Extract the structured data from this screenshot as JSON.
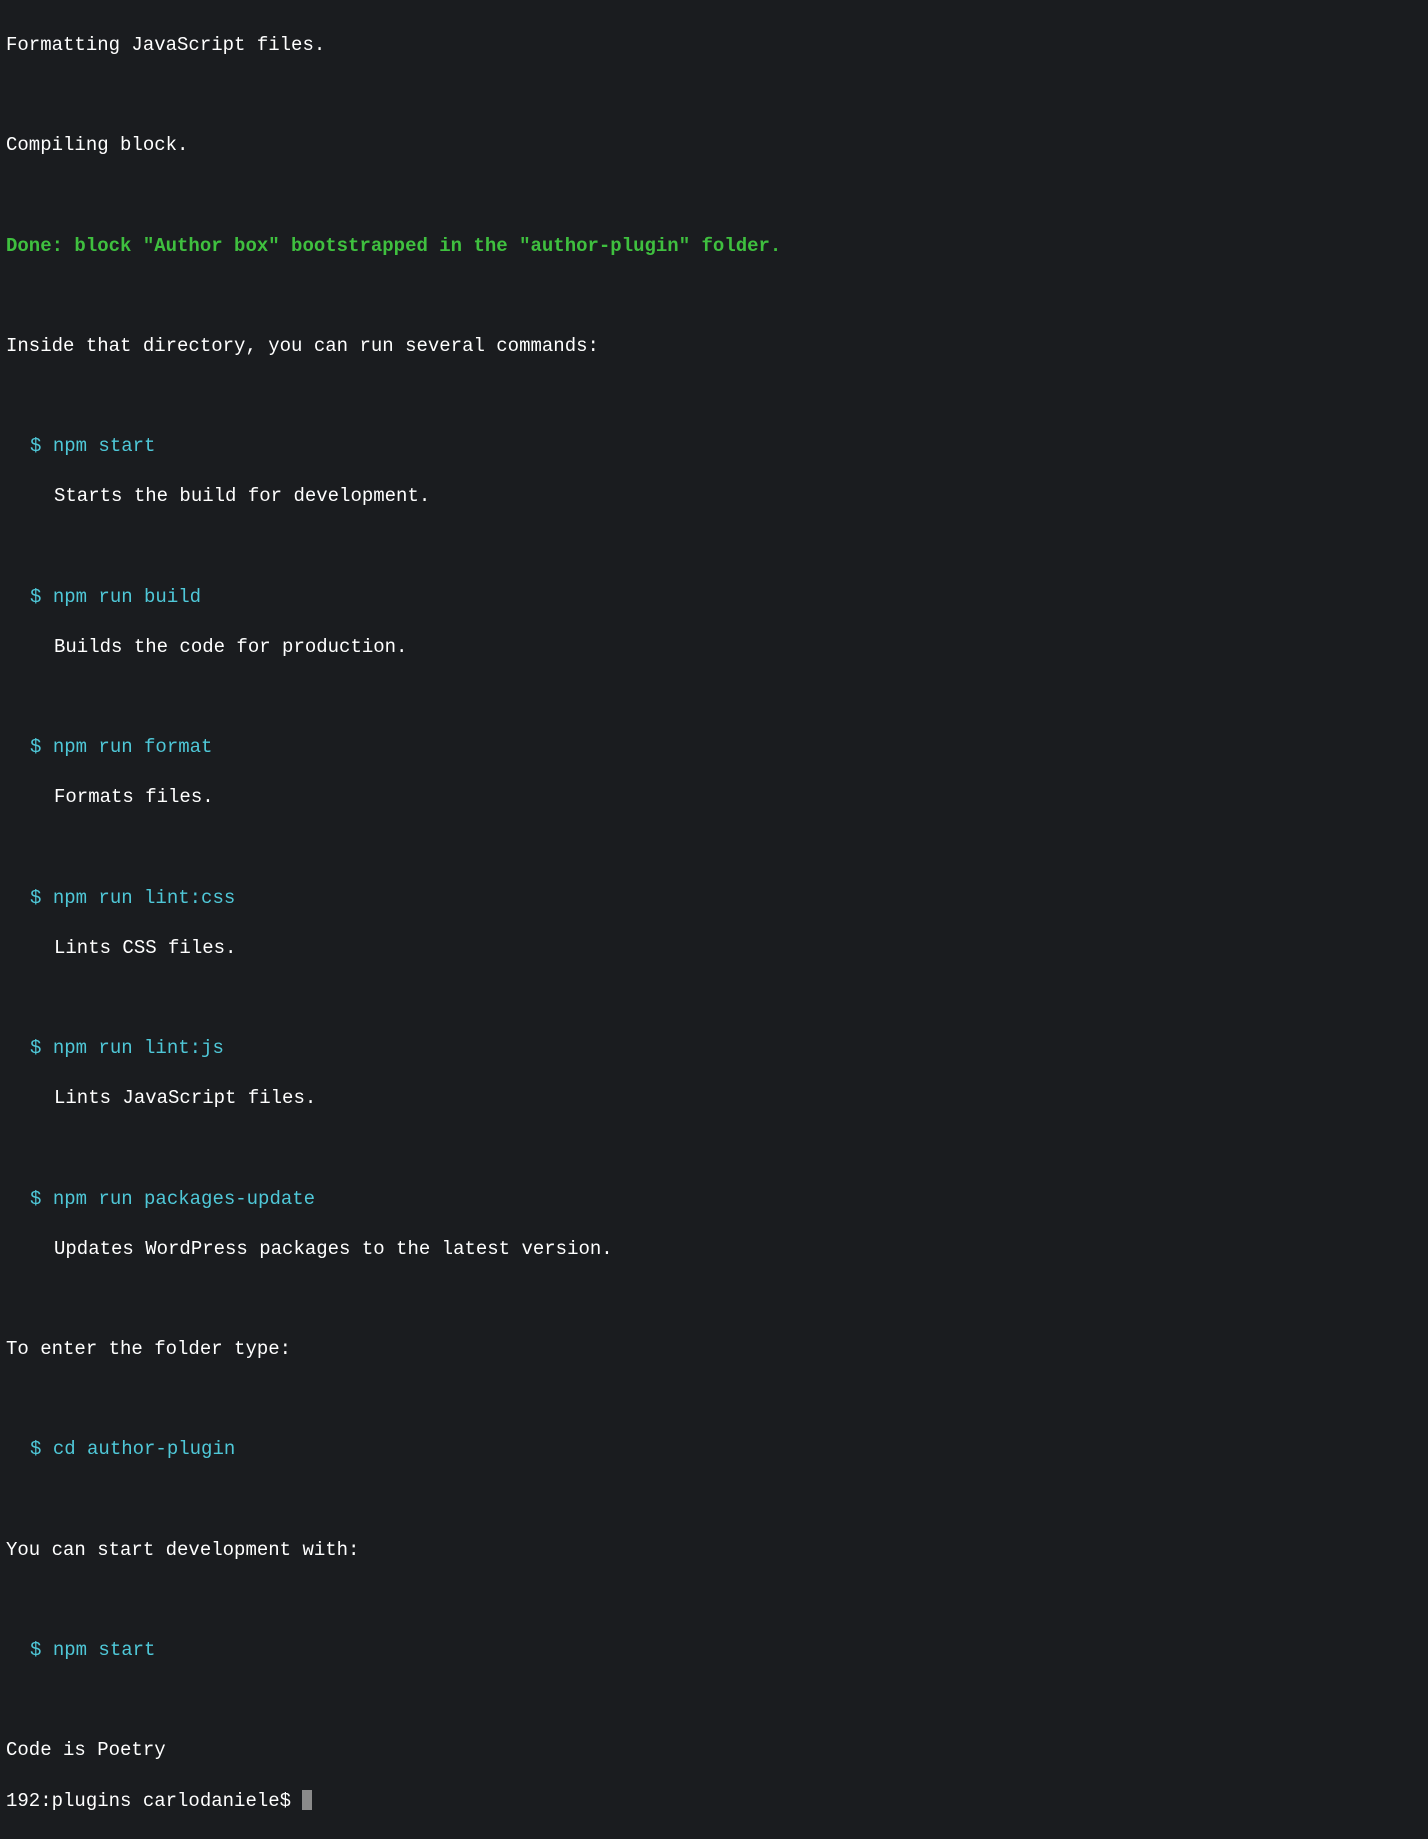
{
  "terminal": {
    "status_formatting": "Formatting JavaScript files.",
    "status_compiling": "Compiling block.",
    "done_message": "Done: block \"Author box\" bootstrapped in the \"author-plugin\" folder.",
    "intro": "Inside that directory, you can run several commands:",
    "commands": [
      {
        "cmd": "npm start",
        "desc": "Starts the build for development."
      },
      {
        "cmd": "npm run build",
        "desc": "Builds the code for production."
      },
      {
        "cmd": "npm run format",
        "desc": "Formats files."
      },
      {
        "cmd": "npm run lint:css",
        "desc": "Lints CSS files."
      },
      {
        "cmd": "npm run lint:js",
        "desc": "Lints JavaScript files."
      },
      {
        "cmd": "npm run packages-update",
        "desc": "Updates WordPress packages to the latest version."
      }
    ],
    "enter_folder_text": "To enter the folder type:",
    "cd_cmd": "cd author-plugin",
    "start_dev_text": "You can start development with:",
    "start_cmd": "npm start",
    "tagline": "Code is Poetry",
    "prompt": "192:plugins carlodaniele$ ",
    "dollar": "$ "
  }
}
